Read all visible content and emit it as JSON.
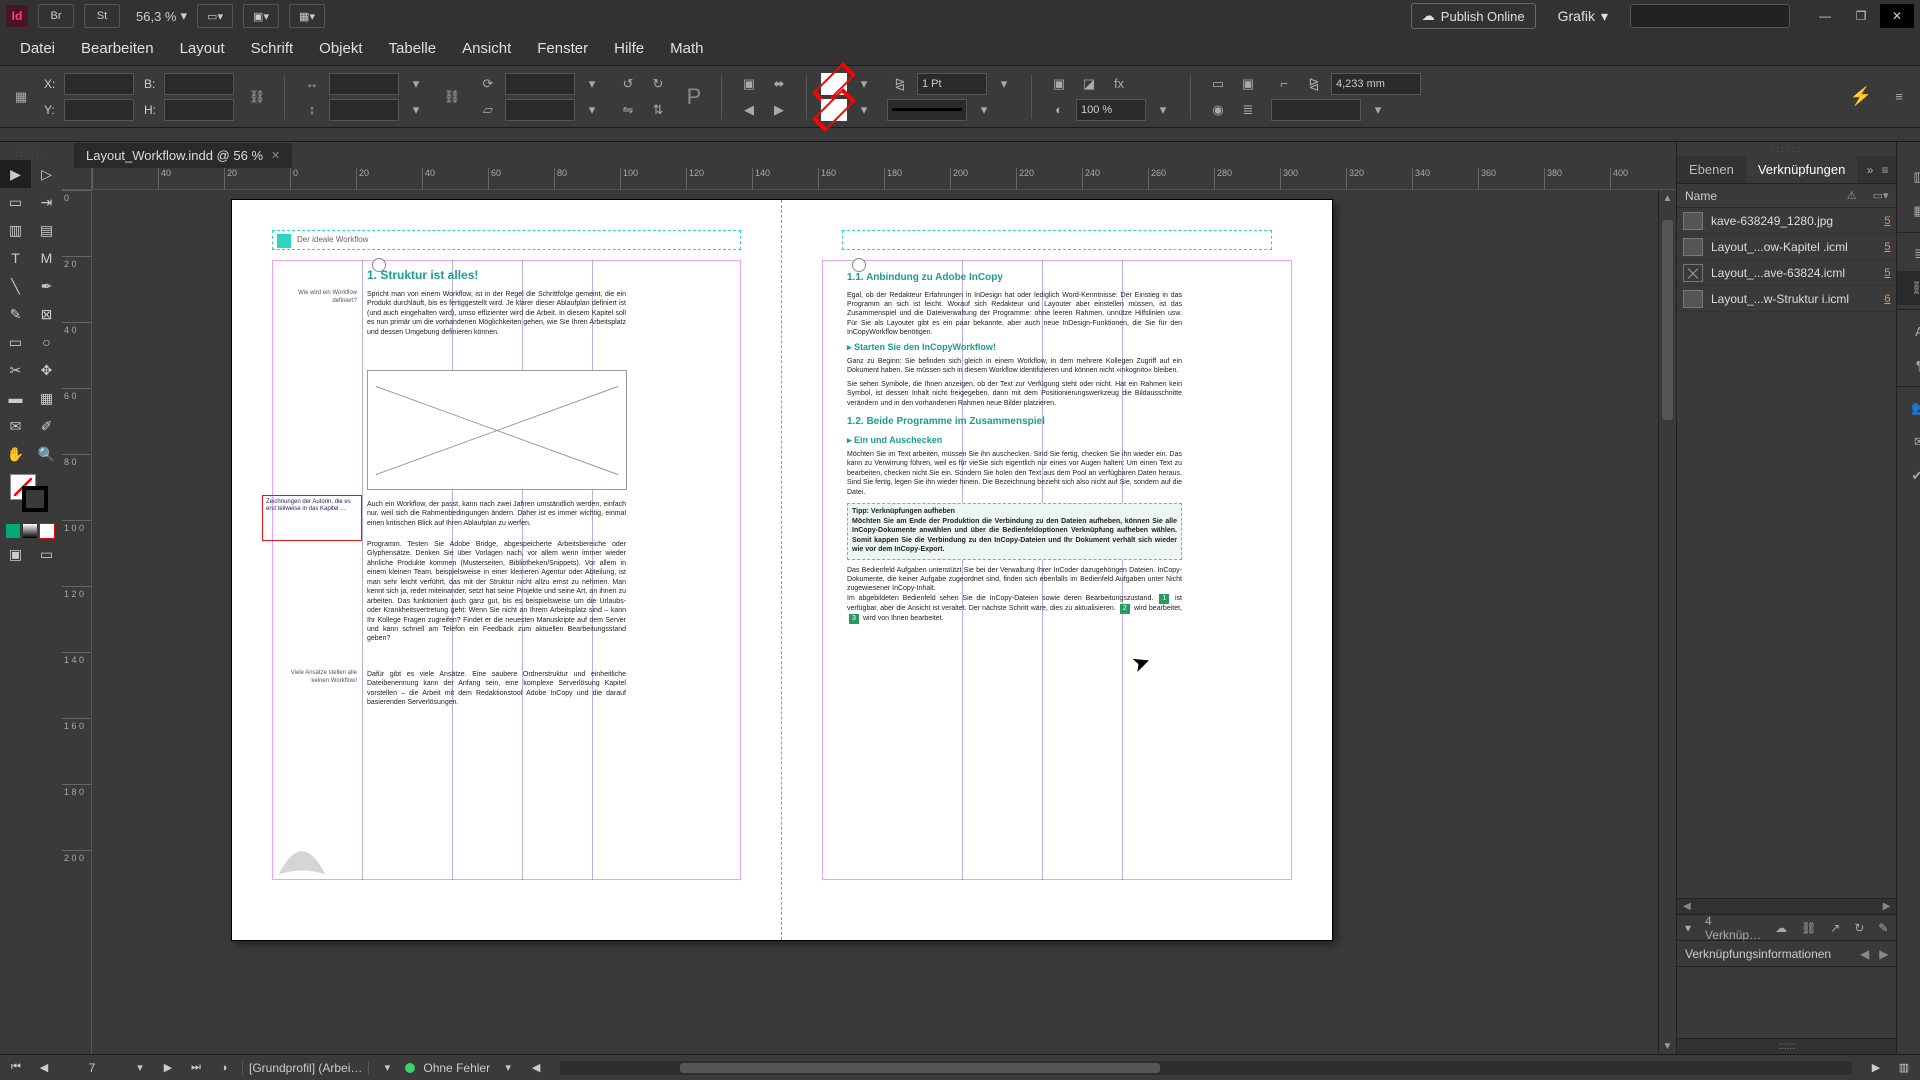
{
  "app": {
    "id_badge": "Id",
    "br": "Br",
    "st": "St",
    "zoom": "56,3 %"
  },
  "titlebar": {
    "publish": "Publish Online",
    "workspace": "Grafik"
  },
  "window": {
    "min": "—",
    "max": "❐",
    "close": "✕"
  },
  "menus": [
    "Datei",
    "Bearbeiten",
    "Layout",
    "Schrift",
    "Objekt",
    "Tabelle",
    "Ansicht",
    "Fenster",
    "Hilfe",
    "Math"
  ],
  "control": {
    "x": "X:",
    "y": "Y:",
    "w": "B:",
    "h": "H:",
    "stroke_weight": "1 Pt",
    "gap": "4,233 mm",
    "opacity": "100 %"
  },
  "doc_tab": {
    "title": "Layout_Workflow.indd @ 56 %"
  },
  "ruler_h": [
    "",
    "40",
    "20",
    "0",
    "20",
    "40",
    "60",
    "80",
    "100",
    "120",
    "140",
    "160",
    "180",
    "200",
    "220",
    "240",
    "260",
    "280",
    "300",
    "320",
    "340",
    "360",
    "380",
    "400"
  ],
  "ruler_v": [
    "0",
    "2 0",
    "4 0",
    "6 0",
    "8 0",
    "1 0 0",
    "1 2 0",
    "1 4 0",
    "1 6 0",
    "1 8 0",
    "2 0 0"
  ],
  "page_left": {
    "running_head": "Der ideale Workflow",
    "h1": "1.  Struktur ist alles!",
    "sidenote1": "Wie wird ein Workflow definiert?",
    "para1": "Spricht man von einem Workflow, ist in der Regel die Schrittfolge gemeint, die ein Produkt durchläuft, bis es fertiggestellt wird. Je klarer dieser Ablaufplan definiert ist (und auch eingehalten wird), umso effizienter wird die Arbeit. In diesem Kapitel soll es nun primär um die vorhandenen Möglichkeiten gehen, wie Sie Ihren Arbeitsplatz und dessen Umgebung definieren können.",
    "redframe": "Zeichnungen der Autorin, die es erst teilweise in das Kapitel …",
    "para2": "Auch ein Workflow, der passt, kann nach zwei Jahren umständlich werden, einfach nur, weil sich die Rahmenbedingungen ändern. Daher ist es immer wichtig, einmal einen kritischen Blick auf Ihren Ablaufplan zu werfen.",
    "para3": "Programm. Testen Sie Adobe Bridge, abgespeicherte Arbeitsbereiche oder Glyphensätze. Denken Sie über Vorlagen nach, vor allem wenn immer wieder ähnliche Produkte kommen (Musterseiten, Bibliotheken/Snippets). Vor allem in einem kleinen Team, beispielsweise in einer kleineren Agentur oder Abteilung, ist man sehr leicht verführt, das mit der Struktur nicht allzu ernst zu nehmen. Man kennt sich ja, redet miteinander, setzt hat seine Projekte und seine Art, an ihnen zu arbeiten. Das funktioniert auch ganz gut, bis es beispielsweise um die Urlaubs- oder Krankheitsvertretung geht: Wenn Sie nicht an Ihrem Arbeitsplatz sind – kann Ihr Kollege Fragen zugreifen? Findet er die neuesten Manuskripte auf dem Server und kann schnell am Telefon ein Feedback zum aktuellen Bearbeitungsstand geben?",
    "sidenote2": "Viele Ansätze stellen alle keinen Workflow!",
    "para4": "Dafür gibt es viele Ansätze. Eine saubere Ordnerstruktur und einheitliche Dateibenennung kann der Anfang sein, eine komplexe Serverlösung Kapitel vorstellen – die Arbeit mit dem Redaktionstool Adobe InCopy und die darauf basierenden Serverlösungen."
  },
  "page_right": {
    "h2": "1.1.  Anbindung zu Adobe InCopy",
    "para1": "Egal, ob der Redakteur Erfahrungen in InDesign hat oder lediglich Word-Kenntnisse: Der Einstieg in das Programm an sich ist leicht. Worauf sich Redakteur und Layouter aber einstellen müssen, ist das Zusammenspiel und die Dateiverwaltung der Programme: ohne leeren Rahmen, unnütze Hilfslinien usw. Für Sie als Layouter gibt es ein paar bekannte, aber auch neue InDesign-Funktionen, die Sie für den InCopyWorkflow benötigen.",
    "h3a": "▸  Starten Sie den InCopyWorkflow!",
    "para2": "Ganz zu Beginn: Sie befinden sich gleich in einem Workflow, in dem mehrere Kollegen Zugriff auf ein Dokument haben. Sie müssen sich in diesem Workflow identifizieren und können nicht »inkognito« bleiben.",
    "para3": "Sie sehen Symbole, die Ihnen anzeigen, ob der Text zur Verfügung steht oder nicht. Hat ein Rahmen kein Symbol, ist dessen Inhalt nicht freigegeben, dann mit dem Positionierungswerkzeug die Bildausschnitte verändern und in den vorhandenen Rahmen neue Bilder platzieren.",
    "h2b": "1.2.  Beide Programme im Zusammenspiel",
    "h3b": "▸  Ein und Auschecken",
    "para4": "Möchten Sie im Text arbeiten, müssen Sie ihn auschecken. Sind Sie fertig, checken Sie ihn wieder ein. Das kann zu Verwirrung führen, weil es für vieSie sich eigentlich nur eines vor Augen halten: Um einen Text zu bearbeiten, checken nicht Sie ein. Sondern Sie holen den Text aus dem Pool an verfügbaren Daten heraus. Sind Sie fertig, legen Sie ihn wieder hinein. Die Bezeichnung bezieht sich also nicht auf Sie, sondern auf die Datei.",
    "tip_title": "Tipp: Verknüpfungen aufheben",
    "tip_body": "Möchten Sie am Ende der Produktion die Verbindung zu den Dateien aufheben, können Sie alle InCopy-Dokumente anwählen und über die Bedienfeldoptionen Verknüpfung aufheben wählen. Somit kappen Sie die Verbindung zu den InCopy-Dateien und Ihr Dokument verhält sich wieder wie vor dem InCopy-Export.",
    "para5a": "Das Bedienfeld Aufgaben unterstützt Sie bei der Verwaltung Ihrer InCoder dazugehörigen Dateien. InCopy-Dokumente, die keiner Aufgabe zugeordnet sind, finden sich ebenfalls im Bedienfeld Aufgaben unter Nicht zugewiesener InCopy-Inhalt.",
    "para5b_pre": "Im abgebildeten Bedienfeld sehen Sie die InCopy-Dateien sowie deren Bearbeitungszustand. ",
    "chip1": "1",
    "mid1": " ist verfügbar, aber die Ansicht ist veraltet. Der nächste Schritt wäre, dies zu aktualisieren. ",
    "chip2": "2",
    "mid2": " wird bearbeitet, ",
    "chip3": "3",
    "mid3": " wird von Ihnen bearbeitet."
  },
  "panels": {
    "tab_layers": "Ebenen",
    "tab_links": "Verknüpfungen",
    "col_name": "Name",
    "rows": [
      {
        "name": "kave-638249_1280.jpg",
        "page": "5"
      },
      {
        "name": "Layout_...ow-Kapitel .icml",
        "page": "5"
      },
      {
        "name": "Layout_...ave-63824.icml",
        "page": "5"
      },
      {
        "name": "Layout_...w-Struktur i.icml",
        "page": "6"
      }
    ],
    "count": "4 Verknüp…",
    "info_header": "Verknüpfungsinformationen"
  },
  "dock": {
    "pages": "Seiten",
    "swatches": "Farbfelder",
    "layers": "Ebenen",
    "links": "Verknüpfungen",
    "char": "Zeichenformate",
    "para": "Absatzformate",
    "tasks": "Aufgaben",
    "notes": "Notizen",
    "track": "Änderungen verfolgen"
  },
  "status": {
    "page": "7",
    "profile": "[Grundprofil] (Arbei…",
    "errors": "Ohne Fehler"
  }
}
